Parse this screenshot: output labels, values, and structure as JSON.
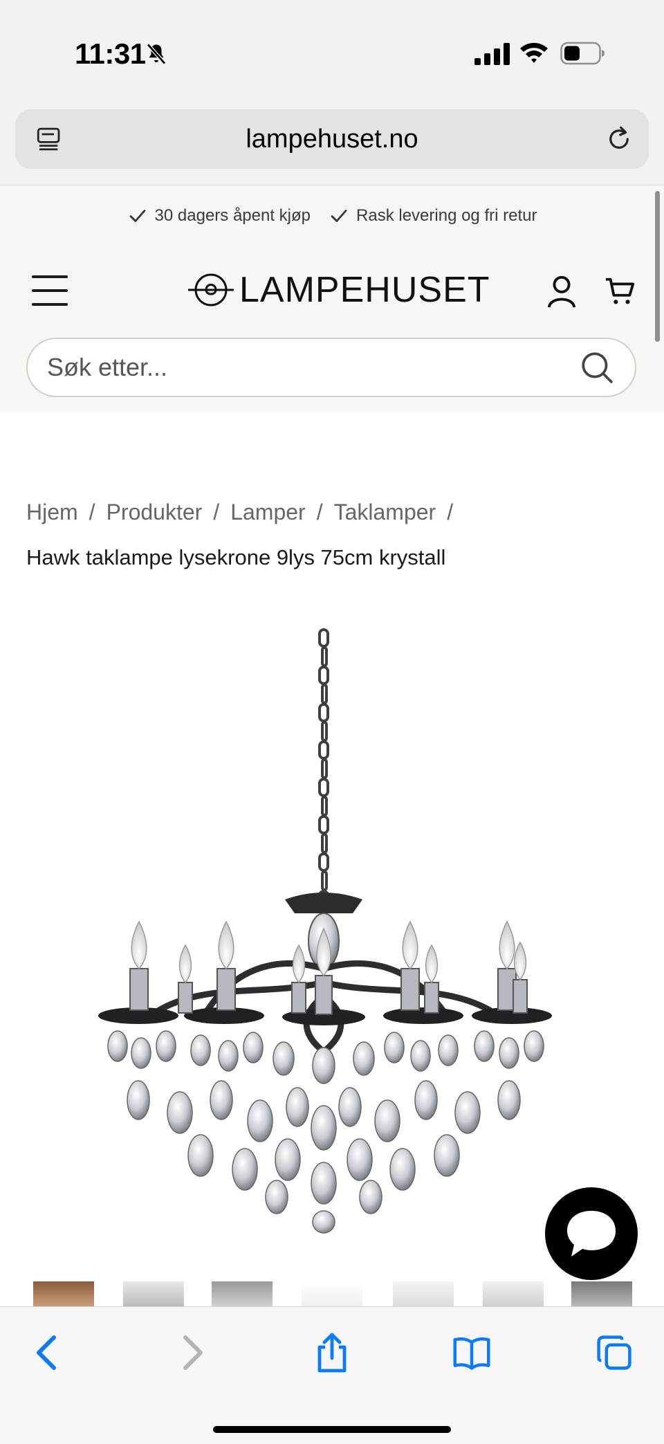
{
  "status_bar": {
    "time": "11:31",
    "icons": [
      "bell-slash-icon",
      "cellular-signal-icon",
      "wifi-icon",
      "battery-icon"
    ]
  },
  "browser": {
    "url": "lampehuset.no",
    "icons": [
      "tab-overview-icon",
      "reload-icon"
    ]
  },
  "header": {
    "usps": [
      "30 dagers åpent kjøp",
      "Rask levering og fri retur"
    ],
    "logo_text": "LAMPEHUSET",
    "search_placeholder": "Søk etter...",
    "icons": [
      "menu-icon",
      "account-icon",
      "cart-icon",
      "search-icon"
    ]
  },
  "breadcrumb": {
    "items": [
      "Hjem",
      "Produkter",
      "Lamper",
      "Taklamper"
    ],
    "separator": "/"
  },
  "product": {
    "title": "Hawk taklampe lysekrone 9lys 75cm krystall",
    "image_icon": "chandelier-image"
  },
  "chat": {
    "icon": "chat-bubble-icon"
  },
  "thumbnails": {
    "count": 7
  },
  "toolbar": {
    "icons": [
      "back-icon",
      "forward-icon",
      "share-icon",
      "bookmarks-icon",
      "tabs-icon"
    ]
  },
  "colors": {
    "header_bg": "#f7f6f2",
    "chrome_bg": "#f2f2f2",
    "safari_blue": "#0a7aff",
    "chat_bg": "#000000"
  }
}
